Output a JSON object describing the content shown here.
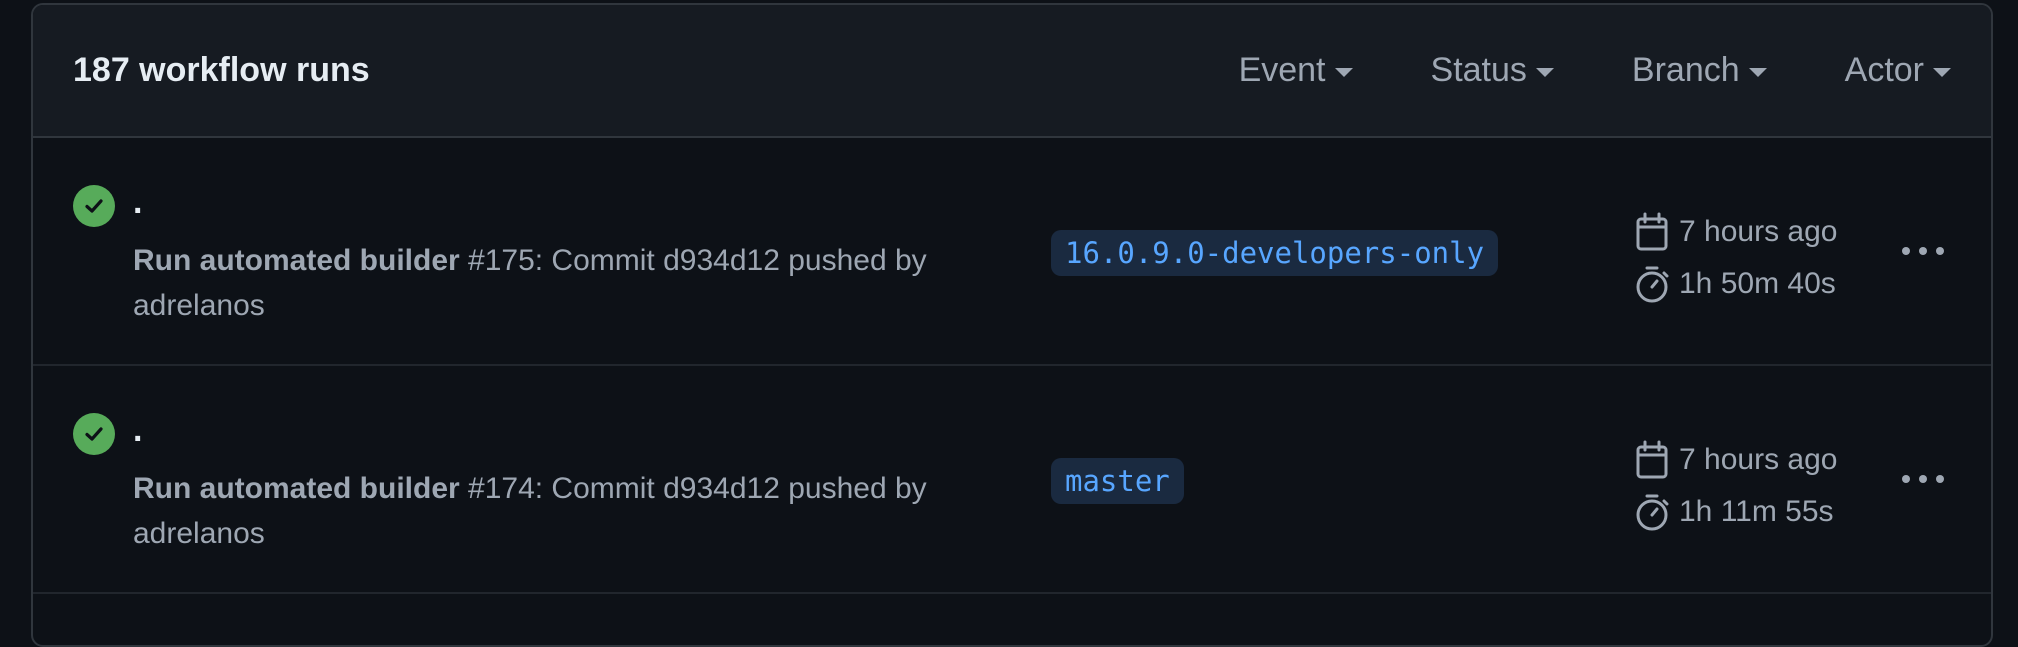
{
  "header": {
    "title": "187 workflow runs",
    "filters": [
      {
        "label": "Event"
      },
      {
        "label": "Status"
      },
      {
        "label": "Branch"
      },
      {
        "label": "Actor"
      }
    ]
  },
  "runs": [
    {
      "title": ".",
      "workflow": "Run automated builder",
      "details": " #175: Commit d934d12 pushed by adrelanos",
      "branch": "16.0.9.0-developers-only",
      "time_ago": "7 hours ago",
      "duration": "1h 50m 40s",
      "status": "success"
    },
    {
      "title": ".",
      "workflow": "Run automated builder",
      "details": " #174: Commit d934d12 pushed by adrelanos",
      "branch": "master",
      "time_ago": "7 hours ago",
      "duration": "1h 11m 55s",
      "status": "success"
    }
  ],
  "icons": {
    "status": "check-circle-icon",
    "time": "calendar-icon",
    "duration": "stopwatch-icon",
    "menu": "kebab-icon"
  },
  "colors": {
    "success": "#57ab5a",
    "branch_text": "#58a6ff",
    "branch_bg": "#1a2a40",
    "background": "#0d1117",
    "header_bg": "#161b22"
  }
}
